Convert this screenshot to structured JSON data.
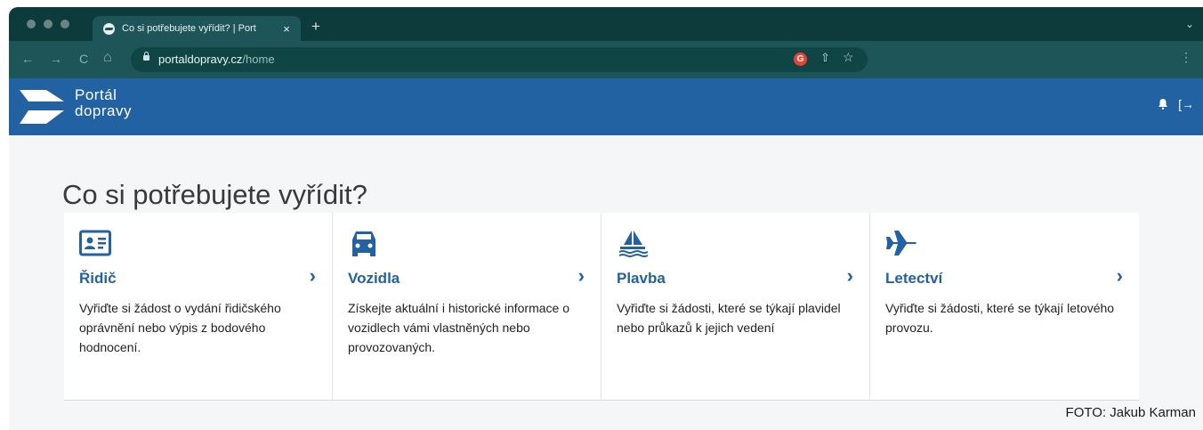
{
  "browser": {
    "tab_title": "Co si potřebujete vyřídit? | Port",
    "tab_close": "×",
    "new_tab": "+",
    "url_host": "portaldopravy.cz",
    "url_path": "/home",
    "nav_back": "←",
    "nav_forward": "→",
    "nav_reload": "C",
    "nav_home": "⌂",
    "google_badge": "G",
    "share_glyph": "⇧",
    "star_glyph": "☆",
    "menu_glyph": "⋮",
    "chevron_glyph": "⌄"
  },
  "site": {
    "logo_line1": "Portál",
    "logo_line2": "dopravy",
    "logout_glyph": "[→"
  },
  "main": {
    "heading": "Co si potřebujete vyřídit?",
    "chevron": "›",
    "cards": [
      {
        "icon": "id-card-icon",
        "title": "Řidič",
        "text": "Vyřiďte si žádost o vydání řidičského oprávnění nebo výpis z bodového hodnocení."
      },
      {
        "icon": "car-icon",
        "title": "Vozidla",
        "text": "Získejte aktuální i historické informace o vozidlech vámi vlastněných nebo provozovaných."
      },
      {
        "icon": "sailboat-icon",
        "title": "Plavba",
        "text": "Vyřiďte si žádosti, které se týkají plavidel nebo průkazů k jejich vedení"
      },
      {
        "icon": "airplane-icon",
        "title": "Letectví",
        "text": "Vyřiďte si žádosti, které se týkají letového provozu."
      }
    ]
  },
  "credit": "FOTO: Jakub Karman",
  "colors": {
    "brand_blue": "#2362a2",
    "browser_dark": "#0d3a3a",
    "browser_mid": "#1d5558"
  }
}
